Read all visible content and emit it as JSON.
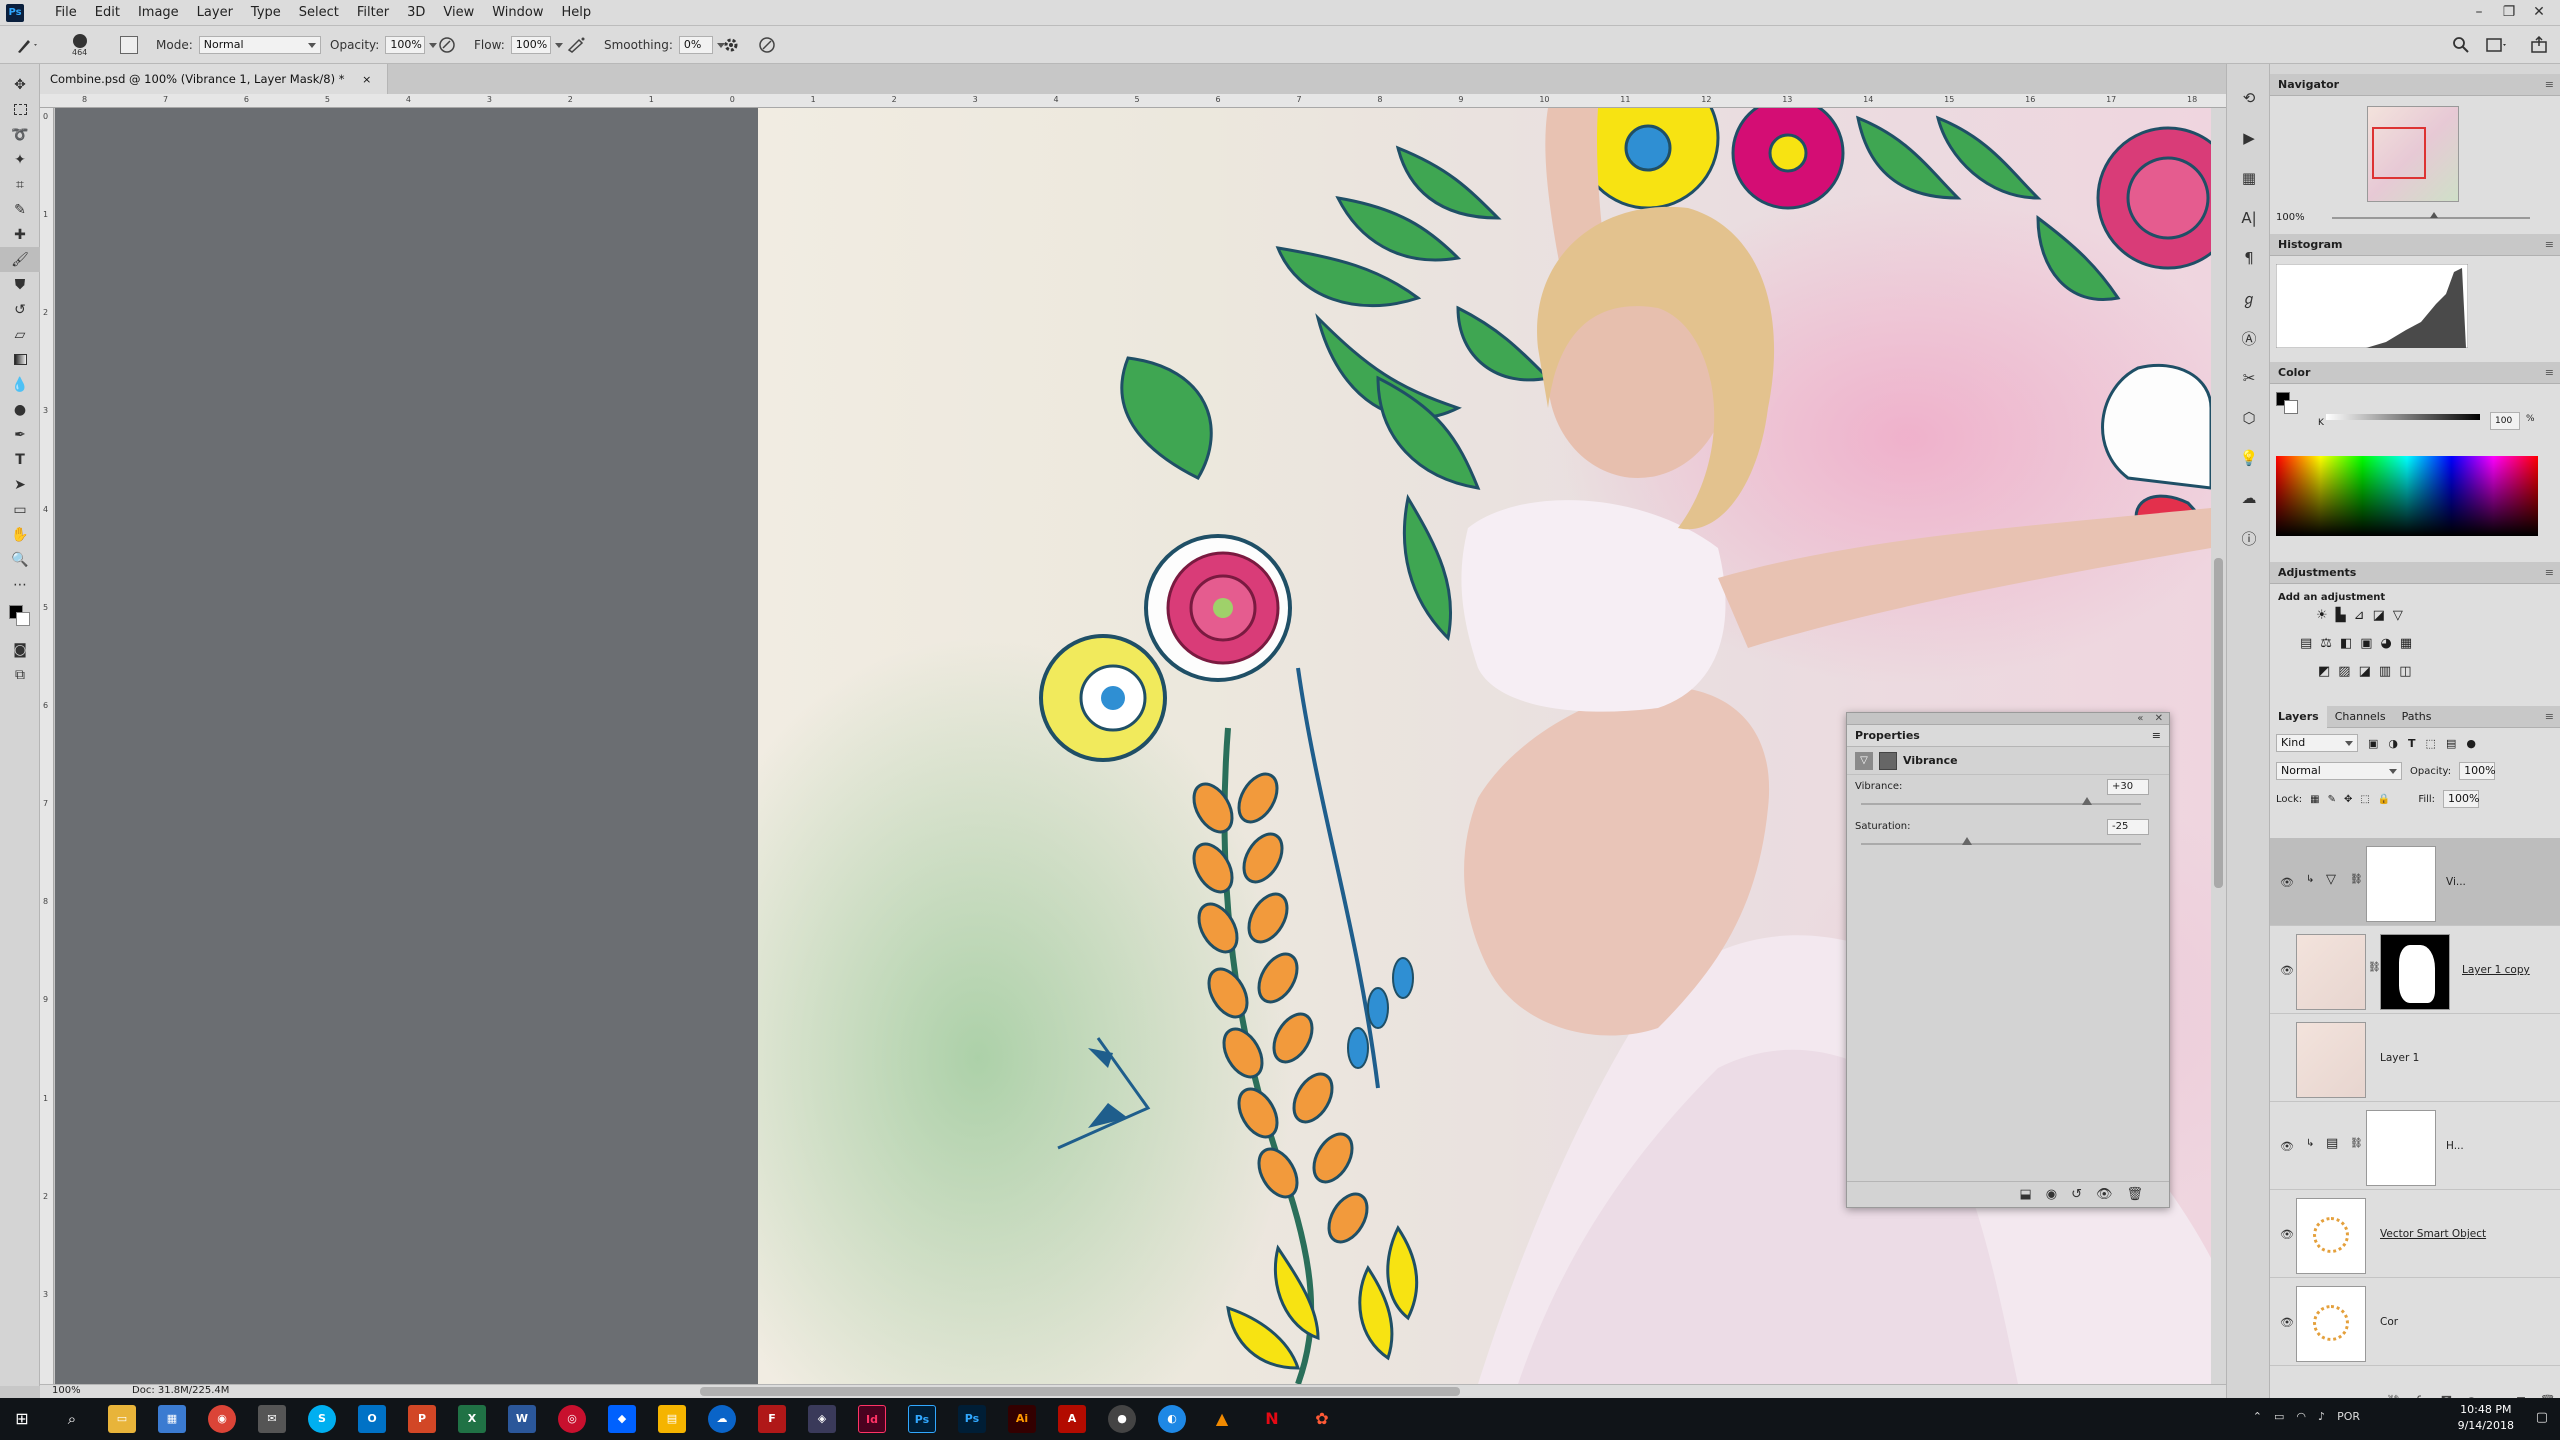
{
  "menubar": {
    "logo": "Ps",
    "items": [
      "File",
      "Edit",
      "Image",
      "Layer",
      "Type",
      "Select",
      "Filter",
      "3D",
      "View",
      "Window",
      "Help"
    ]
  },
  "options": {
    "brush_size": "464",
    "mode_label": "Mode:",
    "mode_value": "Normal",
    "opacity_label": "Opacity:",
    "opacity_value": "100%",
    "flow_label": "Flow:",
    "flow_value": "100%",
    "smoothing_label": "Smoothing:",
    "smoothing_value": "0%"
  },
  "document": {
    "tab_title": "Combine.psd @ 100% (Vibrance 1, Layer Mask/8) *",
    "close_glyph": "×",
    "ruler_top": [
      "8",
      "7",
      "6",
      "5",
      "4",
      "3",
      "2",
      "1",
      "0",
      "1",
      "2",
      "3",
      "4",
      "5",
      "6",
      "7",
      "8",
      "9",
      "10",
      "11",
      "12",
      "13",
      "14",
      "15",
      "16",
      "17",
      "18"
    ],
    "ruler_left": [
      "0",
      "1",
      "2",
      "3",
      "4",
      "5",
      "6",
      "7",
      "8",
      "9",
      "1",
      "2",
      "3"
    ],
    "zoom": "100%",
    "doc_size": "Doc: 31.8M/225.4M"
  },
  "navigator": {
    "title": "Navigator",
    "zoom": "100%"
  },
  "histogram": {
    "title": "Histogram"
  },
  "color_panel": {
    "title": "Color",
    "channel_label": "K",
    "value": "100",
    "unit": "%"
  },
  "adjustments": {
    "title": "Adjustments",
    "subtitle": "Add an adjustment"
  },
  "properties": {
    "title": "Properties",
    "type_label": "Vibrance",
    "vibrance_label": "Vibrance:",
    "vibrance_value": "+30",
    "vibrance_level": 0.8,
    "saturation_label": "Saturation:",
    "saturation_value": "-25",
    "saturation_level": 0.375
  },
  "layers_panel": {
    "tabs": [
      "Layers",
      "Channels",
      "Paths"
    ],
    "filter_label": "Kind",
    "blend_mode": "Normal",
    "opacity_label": "Opacity:",
    "opacity_value": "100%",
    "lock_label": "Lock:",
    "fill_label": "Fill:",
    "fill_value": "100%",
    "layers": [
      {
        "name": "Vi...",
        "visible": true,
        "selected": true
      },
      {
        "name": "Layer 1 copy",
        "visible": true,
        "selected": false
      },
      {
        "name": "Layer 1",
        "visible": false,
        "selected": false
      },
      {
        "name": "H...",
        "visible": true,
        "selected": false
      },
      {
        "name": "Vector Smart Object",
        "visible": true,
        "selected": false
      },
      {
        "name": "Cor",
        "visible": true,
        "selected": false
      }
    ]
  },
  "taskbar": {
    "time": "10:48 PM",
    "date": "9/14/2018",
    "lang": "POR",
    "apps": [
      "Id",
      "Ps",
      "Ps",
      "Ai"
    ]
  },
  "colors": {
    "ps_blue": "#31a8ff",
    "pasteboard": "#6b6e72",
    "taskbar": "#101418"
  }
}
